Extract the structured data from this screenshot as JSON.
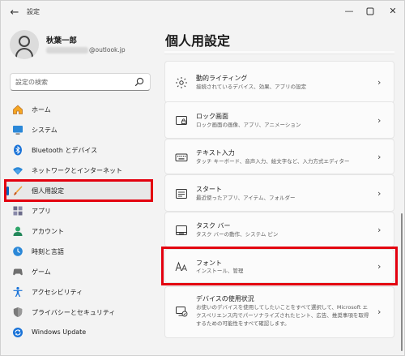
{
  "window": {
    "title": "設定",
    "back_icon": "back-arrow-icon",
    "controls": [
      "minimize",
      "maximize",
      "close"
    ]
  },
  "profile": {
    "name": "秋葉一郎",
    "email_visible_suffix": "@outlook.jp"
  },
  "search": {
    "placeholder": "設定の検索",
    "icon": "search-icon"
  },
  "sidebar": {
    "items": [
      {
        "label": "ホーム",
        "icon": "home-icon"
      },
      {
        "label": "システム",
        "icon": "system-icon"
      },
      {
        "label": "Bluetooth とデバイス",
        "icon": "bluetooth-icon"
      },
      {
        "label": "ネットワークとインターネット",
        "icon": "wifi-icon"
      },
      {
        "label": "個人用設定",
        "icon": "personalization-brush-icon",
        "selected": true
      },
      {
        "label": "アプリ",
        "icon": "apps-icon"
      },
      {
        "label": "アカウント",
        "icon": "account-icon"
      },
      {
        "label": "時刻と言語",
        "icon": "time-language-icon"
      },
      {
        "label": "ゲーム",
        "icon": "gaming-icon"
      },
      {
        "label": "アクセシビリティ",
        "icon": "accessibility-icon"
      },
      {
        "label": "プライバシーとセキュリティ",
        "icon": "shield-icon"
      },
      {
        "label": "Windows Update",
        "icon": "windows-update-icon"
      }
    ]
  },
  "main": {
    "title": "個人用設定",
    "cards": [
      {
        "title": "動的ライティング",
        "desc": "接続されているデバイス、効果、アプリの設定",
        "icon": "dynamic-lighting-icon"
      },
      {
        "title": "ロック画面",
        "desc": "ロック画面の画像、アプリ、アニメーション",
        "icon": "lock-screen-icon"
      },
      {
        "title": "テキスト入力",
        "desc": "タッチ キーボード、音声入力、絵文字など、入力方式エディター",
        "icon": "keyboard-icon"
      },
      {
        "title": "スタート",
        "desc": "最近使ったアプリ、アイテム、フォルダー",
        "icon": "start-icon"
      },
      {
        "title": "タスク バー",
        "desc": "タスク バーの動作、システム ピン",
        "icon": "taskbar-icon"
      },
      {
        "title": "フォント",
        "desc": "インストール、管理",
        "icon": "fonts-icon"
      },
      {
        "title": "デバイスの使用状況",
        "desc": "お使いのデバイスを使用してしたいことをすべて選択して、Microsoft エクスペリエンス内でパーソナライズされたヒント、広告、推奨事項を取得するための可能性をすべて確認します。",
        "icon": "device-usage-icon"
      }
    ]
  },
  "colors": {
    "accent": "#0067c0",
    "highlight_box": "#e3000f"
  }
}
